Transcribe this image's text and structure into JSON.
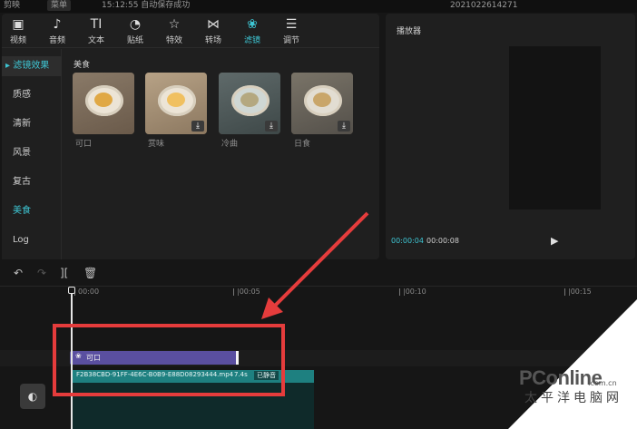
{
  "topbar": {
    "app_name": "剪映",
    "menu": "菜单",
    "save_status": "15:12:55 自动保存成功",
    "project_name": "2021022614271"
  },
  "toolbar": {
    "items": [
      {
        "label": "视频",
        "icon": "video-icon",
        "glyph": "▣"
      },
      {
        "label": "音频",
        "icon": "audio-icon",
        "glyph": "♪"
      },
      {
        "label": "文本",
        "icon": "text-icon",
        "glyph": "TI"
      },
      {
        "label": "贴纸",
        "icon": "sticker-icon",
        "glyph": "◔"
      },
      {
        "label": "特效",
        "icon": "effects-icon",
        "glyph": "☆"
      },
      {
        "label": "转场",
        "icon": "transition-icon",
        "glyph": "⋈"
      },
      {
        "label": "滤镜",
        "icon": "filter-icon",
        "glyph": "❀"
      },
      {
        "label": "调节",
        "icon": "adjust-icon",
        "glyph": "☰"
      }
    ],
    "active_color": "#3ec6d4"
  },
  "categories": {
    "header": "滤镜效果",
    "items": [
      "质感",
      "清新",
      "风景",
      "复古",
      "美食",
      "Log"
    ],
    "active": "美食"
  },
  "filters": {
    "section_title": "美食",
    "items": [
      {
        "label": "可口",
        "download": false
      },
      {
        "label": "赏味",
        "download": true
      },
      {
        "label": "冷曲",
        "download": true
      },
      {
        "label": "日食",
        "download": true
      }
    ]
  },
  "player": {
    "title": "播放器",
    "current_time": "00:00:04",
    "total_time": "00:00:08",
    "play_icon": "play-icon"
  },
  "timeline": {
    "toolbar": [
      {
        "name": "undo-icon",
        "glyph": "↶"
      },
      {
        "name": "redo-icon",
        "glyph": "↷"
      },
      {
        "name": "split-icon",
        "glyph": "][",
        "label": ""
      },
      {
        "name": "delete-icon",
        "glyph": "🗑"
      }
    ],
    "ruler": [
      "00:00",
      "|00:05",
      "|00:10",
      "|00:15"
    ],
    "filter_clip": {
      "label": "可口",
      "icon": "filter-icon"
    },
    "video_clip": {
      "filename": "F2B38CBD-91FF-4E6C-B0B9-E88D08293444.mp4",
      "duration": "7.4s",
      "status": "已静音"
    },
    "cover_icon": "cover-icon"
  },
  "annotation_color": "#e53c3c",
  "watermark": {
    "brand": "PConline",
    "domain": ".com.cn",
    "sub": "太平洋电脑网"
  }
}
